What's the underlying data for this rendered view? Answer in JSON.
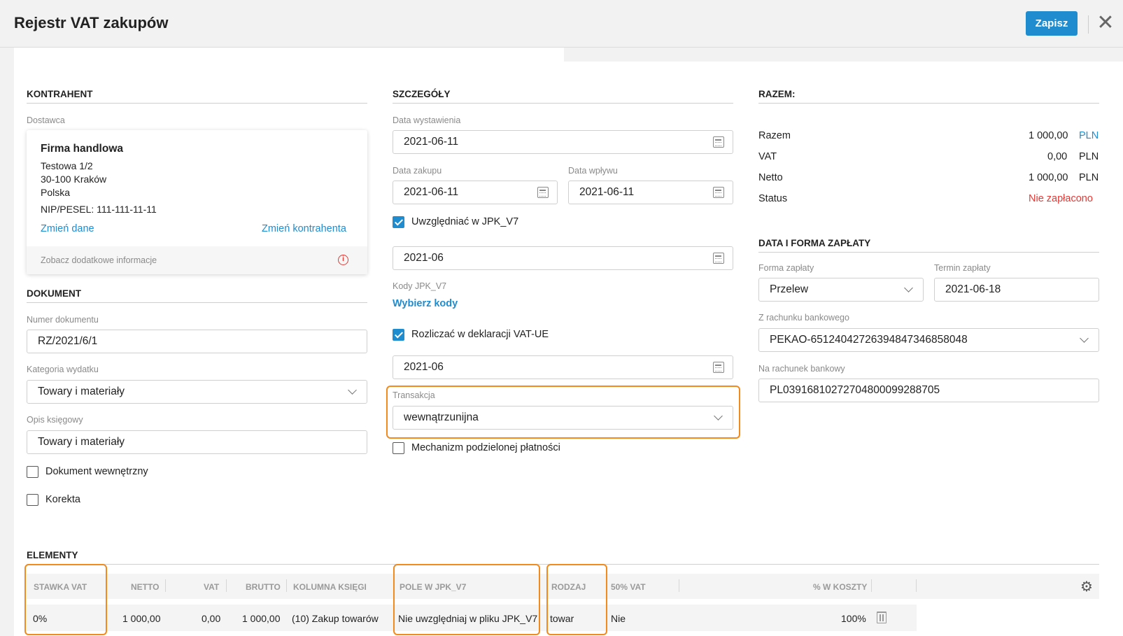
{
  "header": {
    "title": "Rejestr VAT zakupów",
    "save_label": "Zapisz",
    "close_glyph": "✕"
  },
  "kontrahent": {
    "section_title": "KONTRAHENT",
    "supplier_label": "Dostawca",
    "name": "Firma handlowa",
    "address1": "Testowa 1/2",
    "address2": "30-100 Kraków",
    "country": "Polska",
    "nip": "NIP/PESEL: 111-111-11-11",
    "change_data": "Zmień dane",
    "change_contractor": "Zmień kontrahenta",
    "more_info": "Zobacz dodatkowe informacje",
    "info_icon": "i"
  },
  "dokument": {
    "section_title": "DOKUMENT",
    "number_label": "Numer dokumentu",
    "number_value": "RZ/2021/6/1",
    "category_label": "Kategoria wydatku",
    "category_value": "Towary i materiały",
    "desc_label": "Opis księgowy",
    "desc_value": "Towary i materiały",
    "internal_label": "Dokument wewnętrzny",
    "internal_checked": false,
    "correction_label": "Korekta",
    "correction_checked": false
  },
  "szczegoly": {
    "section_title": "SZCZEGÓŁY",
    "issue_date_label": "Data wystawienia",
    "issue_date": "2021-06-11",
    "purchase_date_label": "Data zakupu",
    "purchase_date": "2021-06-11",
    "receipt_date_label": "Data wpływu",
    "receipt_date": "2021-06-11",
    "jpk_label": "Uwzględniać w JPK_V7",
    "jpk_checked": true,
    "jpk_period": "2021-06",
    "codes_label": "Kody JPK_V7",
    "codes_link": "Wybierz kody",
    "vatue_label": "Rozliczać w deklaracji VAT-UE",
    "vatue_checked": true,
    "vatue_period": "2021-06",
    "transaction_label": "Transakcja",
    "transaction_value": "wewnątrzunijna",
    "split_label": "Mechanizm podzielonej płatności",
    "split_checked": false
  },
  "razem": {
    "section_title": "RAZEM:",
    "rows": [
      {
        "label": "Razem",
        "value": "1 000,00",
        "currency": "PLN"
      },
      {
        "label": "VAT",
        "value": "0,00",
        "currency": "PLN"
      },
      {
        "label": "Netto",
        "value": "1 000,00",
        "currency": "PLN"
      }
    ],
    "status_label": "Status",
    "status_value": "Nie zapłacono",
    "status_color": "#e53935",
    "link_color": "#1f8ccf"
  },
  "platnosc": {
    "section_title": "DATA I FORMA ZAPŁATY",
    "method_label": "Forma zapłaty",
    "method_value": "Przelew",
    "due_label": "Termin zapłaty",
    "due_value": "2021-06-18",
    "from_account_label": "Z rachunku bankowego",
    "from_account_value": "PEKAO-65124042726394847346858048",
    "to_account_label": "Na rachunek bankowy",
    "to_account_value": "PL03916810272704800099288705"
  },
  "elementy": {
    "section_title": "ELEMENTY",
    "headers": {
      "stawka": "STAWKA VAT",
      "netto": "NETTO",
      "vat": "VAT",
      "brutto": "BRUTTO",
      "kolumna": "KOLUMNA KSIĘGI",
      "pole": "POLE W JPK_V7",
      "rodzaj": "RODZAJ",
      "vat50": "50% VAT",
      "koszty": "% W KOSZTY"
    },
    "row": {
      "stawka": "0%",
      "netto": "1 000,00",
      "vat": "0,00",
      "brutto": "1 000,00",
      "kolumna": "(10) Zakup towarów",
      "pole": "Nie uwzględniaj w pliku JPK_V7",
      "rodzaj": "towar",
      "vat50": "Nie",
      "koszty": "100%"
    },
    "gear_glyph": "⚙"
  },
  "colors": {
    "accent": "#1f8ccf",
    "highlight": "#f28a1e",
    "danger": "#e53935"
  }
}
